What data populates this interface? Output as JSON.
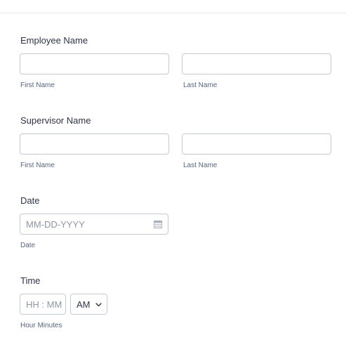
{
  "employee_name": {
    "label": "Employee Name",
    "first_sublabel": "First Name",
    "last_sublabel": "Last Name",
    "first_value": "",
    "last_value": ""
  },
  "supervisor_name": {
    "label": "Supervisor Name",
    "first_sublabel": "First Name",
    "last_sublabel": "Last Name",
    "first_value": "",
    "last_value": ""
  },
  "date": {
    "label": "Date",
    "placeholder": "MM-DD-YYYY",
    "sublabel": "Date",
    "icon": "calendar-icon"
  },
  "time": {
    "label": "Time",
    "placeholder": "HH : MM",
    "ampm_selected": "AM",
    "sublabel": "Hour Minutes",
    "icon": "chevron-down-icon"
  },
  "colors": {
    "text": "#2c3345",
    "sublabel": "#57647e",
    "placeholder": "#8f96a3",
    "border": "#c3cad8",
    "divider": "#e3e5eb"
  }
}
